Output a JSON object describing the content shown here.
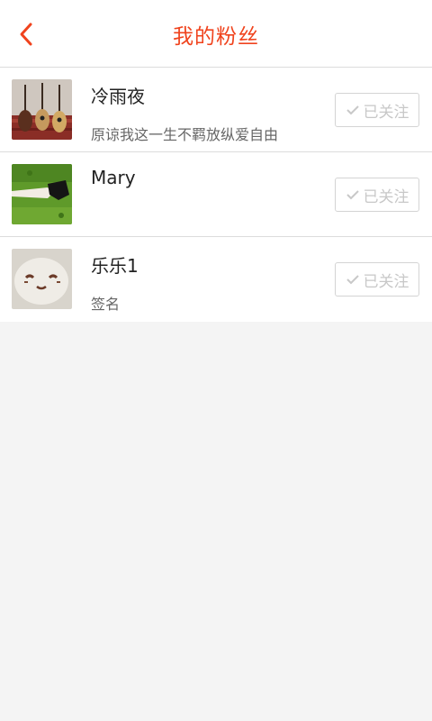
{
  "header": {
    "title": "我的粉丝",
    "back_icon": "chevron-left-icon",
    "accent": "#f0431d"
  },
  "followers": [
    {
      "name": "冷雨夜",
      "signature": "原谅我这一生不羁放纵爱自由",
      "avatar": "guitars-photo",
      "button_label": "已关注"
    },
    {
      "name": "Mary",
      "signature": "",
      "avatar": "grass-hand-photo",
      "button_label": "已关注"
    },
    {
      "name": "乐乐1",
      "signature": "签名",
      "avatar": "plush-face-photo",
      "button_label": "已关注"
    }
  ]
}
